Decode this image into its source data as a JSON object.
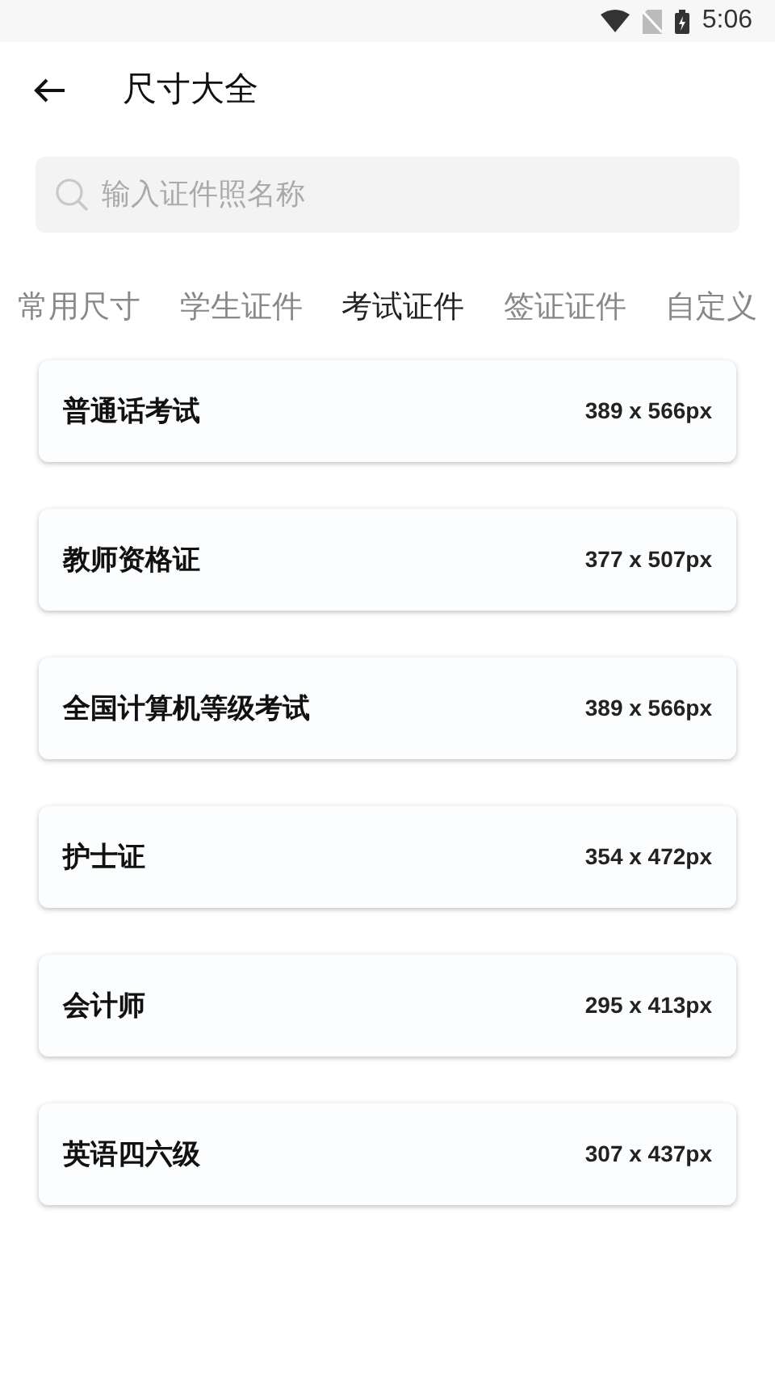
{
  "status_bar": {
    "time": "5:06"
  },
  "header": {
    "title": "尺寸大全"
  },
  "search": {
    "placeholder": "输入证件照名称"
  },
  "tabs": [
    {
      "label": "常用尺寸",
      "selected": false
    },
    {
      "label": "学生证件",
      "selected": false
    },
    {
      "label": "考试证件",
      "selected": true
    },
    {
      "label": "签证证件",
      "selected": false
    },
    {
      "label": "自定义",
      "selected": false
    }
  ],
  "items": [
    {
      "name": "普通话考试",
      "size": "389 x 566px"
    },
    {
      "name": "教师资格证",
      "size": "377 x 507px"
    },
    {
      "name": "全国计算机等级考试",
      "size": "389 x 566px"
    },
    {
      "name": "护士证",
      "size": "354 x 472px"
    },
    {
      "name": "会计师",
      "size": "295 x 413px"
    },
    {
      "name": "英语四六级",
      "size": "307 x 437px"
    }
  ]
}
